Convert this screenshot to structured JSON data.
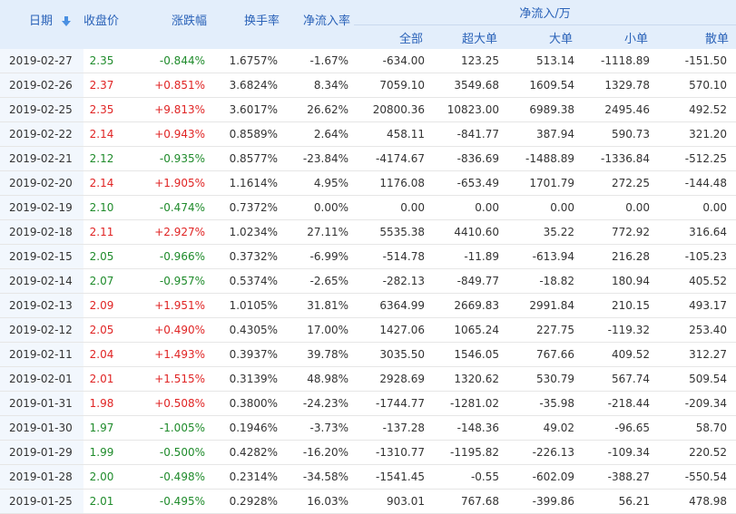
{
  "header": {
    "date": "日期",
    "close": "收盘价",
    "change": "涨跌幅",
    "turnover": "换手率",
    "net_rate": "净流入率",
    "group": "净流入/万",
    "all": "全部",
    "xl": "超大单",
    "large": "大单",
    "small": "小单",
    "retail": "散单"
  },
  "icons": {
    "sort": "sort-down-arrow-icon"
  },
  "colors": {
    "up": "#e02424",
    "down": "#1f8b2b",
    "header_text": "#2a62b8",
    "header_bg": "#e3eefb"
  },
  "rows": [
    {
      "date": "2019-02-27",
      "close": "2.35",
      "change": "-0.844%",
      "turnover": "1.6757%",
      "net_rate": "-1.67%",
      "all": "-634.00",
      "xl": "123.25",
      "large": "513.14",
      "small": "-1118.89",
      "retail": "-151.50",
      "dir": "down"
    },
    {
      "date": "2019-02-26",
      "close": "2.37",
      "change": "+0.851%",
      "turnover": "3.6824%",
      "net_rate": "8.34%",
      "all": "7059.10",
      "xl": "3549.68",
      "large": "1609.54",
      "small": "1329.78",
      "retail": "570.10",
      "dir": "up"
    },
    {
      "date": "2019-02-25",
      "close": "2.35",
      "change": "+9.813%",
      "turnover": "3.6017%",
      "net_rate": "26.62%",
      "all": "20800.36",
      "xl": "10823.00",
      "large": "6989.38",
      "small": "2495.46",
      "retail": "492.52",
      "dir": "up"
    },
    {
      "date": "2019-02-22",
      "close": "2.14",
      "change": "+0.943%",
      "turnover": "0.8589%",
      "net_rate": "2.64%",
      "all": "458.11",
      "xl": "-841.77",
      "large": "387.94",
      "small": "590.73",
      "retail": "321.20",
      "dir": "up"
    },
    {
      "date": "2019-02-21",
      "close": "2.12",
      "change": "-0.935%",
      "turnover": "0.8577%",
      "net_rate": "-23.84%",
      "all": "-4174.67",
      "xl": "-836.69",
      "large": "-1488.89",
      "small": "-1336.84",
      "retail": "-512.25",
      "dir": "down"
    },
    {
      "date": "2019-02-20",
      "close": "2.14",
      "change": "+1.905%",
      "turnover": "1.1614%",
      "net_rate": "4.95%",
      "all": "1176.08",
      "xl": "-653.49",
      "large": "1701.79",
      "small": "272.25",
      "retail": "-144.48",
      "dir": "up"
    },
    {
      "date": "2019-02-19",
      "close": "2.10",
      "change": "-0.474%",
      "turnover": "0.7372%",
      "net_rate": "0.00%",
      "all": "0.00",
      "xl": "0.00",
      "large": "0.00",
      "small": "0.00",
      "retail": "0.00",
      "dir": "down"
    },
    {
      "date": "2019-02-18",
      "close": "2.11",
      "change": "+2.927%",
      "turnover": "1.0234%",
      "net_rate": "27.11%",
      "all": "5535.38",
      "xl": "4410.60",
      "large": "35.22",
      "small": "772.92",
      "retail": "316.64",
      "dir": "up"
    },
    {
      "date": "2019-02-15",
      "close": "2.05",
      "change": "-0.966%",
      "turnover": "0.3732%",
      "net_rate": "-6.99%",
      "all": "-514.78",
      "xl": "-11.89",
      "large": "-613.94",
      "small": "216.28",
      "retail": "-105.23",
      "dir": "down"
    },
    {
      "date": "2019-02-14",
      "close": "2.07",
      "change": "-0.957%",
      "turnover": "0.5374%",
      "net_rate": "-2.65%",
      "all": "-282.13",
      "xl": "-849.77",
      "large": "-18.82",
      "small": "180.94",
      "retail": "405.52",
      "dir": "down"
    },
    {
      "date": "2019-02-13",
      "close": "2.09",
      "change": "+1.951%",
      "turnover": "1.0105%",
      "net_rate": "31.81%",
      "all": "6364.99",
      "xl": "2669.83",
      "large": "2991.84",
      "small": "210.15",
      "retail": "493.17",
      "dir": "up"
    },
    {
      "date": "2019-02-12",
      "close": "2.05",
      "change": "+0.490%",
      "turnover": "0.4305%",
      "net_rate": "17.00%",
      "all": "1427.06",
      "xl": "1065.24",
      "large": "227.75",
      "small": "-119.32",
      "retail": "253.40",
      "dir": "up"
    },
    {
      "date": "2019-02-11",
      "close": "2.04",
      "change": "+1.493%",
      "turnover": "0.3937%",
      "net_rate": "39.78%",
      "all": "3035.50",
      "xl": "1546.05",
      "large": "767.66",
      "small": "409.52",
      "retail": "312.27",
      "dir": "up"
    },
    {
      "date": "2019-02-01",
      "close": "2.01",
      "change": "+1.515%",
      "turnover": "0.3139%",
      "net_rate": "48.98%",
      "all": "2928.69",
      "xl": "1320.62",
      "large": "530.79",
      "small": "567.74",
      "retail": "509.54",
      "dir": "up"
    },
    {
      "date": "2019-01-31",
      "close": "1.98",
      "change": "+0.508%",
      "turnover": "0.3800%",
      "net_rate": "-24.23%",
      "all": "-1744.77",
      "xl": "-1281.02",
      "large": "-35.98",
      "small": "-218.44",
      "retail": "-209.34",
      "dir": "up"
    },
    {
      "date": "2019-01-30",
      "close": "1.97",
      "change": "-1.005%",
      "turnover": "0.1946%",
      "net_rate": "-3.73%",
      "all": "-137.28",
      "xl": "-148.36",
      "large": "49.02",
      "small": "-96.65",
      "retail": "58.70",
      "dir": "down"
    },
    {
      "date": "2019-01-29",
      "close": "1.99",
      "change": "-0.500%",
      "turnover": "0.4282%",
      "net_rate": "-16.20%",
      "all": "-1310.77",
      "xl": "-1195.82",
      "large": "-226.13",
      "small": "-109.34",
      "retail": "220.52",
      "dir": "down"
    },
    {
      "date": "2019-01-28",
      "close": "2.00",
      "change": "-0.498%",
      "turnover": "0.2314%",
      "net_rate": "-34.58%",
      "all": "-1541.45",
      "xl": "-0.55",
      "large": "-602.09",
      "small": "-388.27",
      "retail": "-550.54",
      "dir": "down"
    },
    {
      "date": "2019-01-25",
      "close": "2.01",
      "change": "-0.495%",
      "turnover": "0.2928%",
      "net_rate": "16.03%",
      "all": "903.01",
      "xl": "767.68",
      "large": "-399.86",
      "small": "56.21",
      "retail": "478.98",
      "dir": "down"
    }
  ]
}
